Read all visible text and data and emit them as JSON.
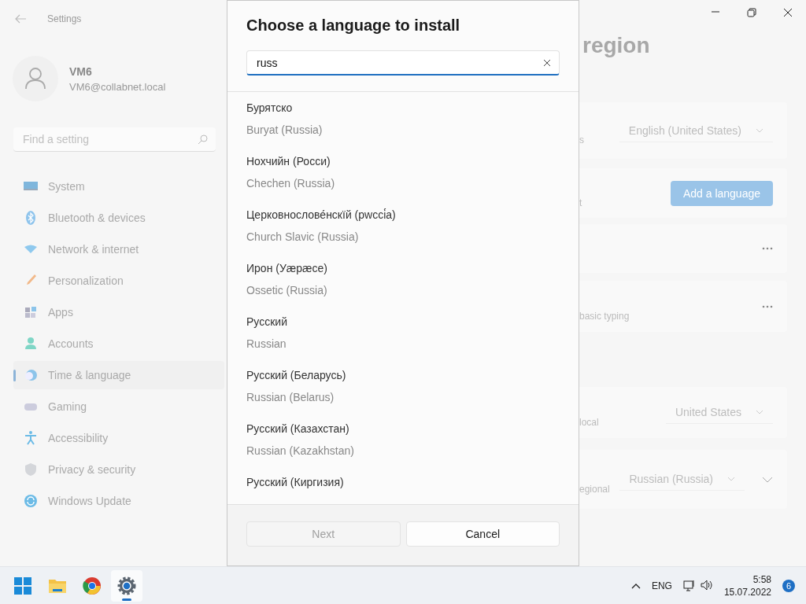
{
  "window": {
    "title": "Settings"
  },
  "account": {
    "name": "VM6",
    "email": "VM6@collabnet.local"
  },
  "sidebar": {
    "search": {
      "placeholder": "Find a setting"
    },
    "items": [
      {
        "label": "System",
        "selected": false
      },
      {
        "label": "Bluetooth & devices",
        "selected": false
      },
      {
        "label": "Network & internet",
        "selected": false
      },
      {
        "label": "Personalization",
        "selected": false
      },
      {
        "label": "Apps",
        "selected": false
      },
      {
        "label": "Accounts",
        "selected": false
      },
      {
        "label": "Time & language",
        "selected": true
      },
      {
        "label": "Gaming",
        "selected": false
      },
      {
        "label": "Accessibility",
        "selected": false
      },
      {
        "label": "Privacy & security",
        "selected": false
      },
      {
        "label": "Windows Update",
        "selected": false
      }
    ]
  },
  "page": {
    "heading": "region",
    "cards": [
      {
        "label": "s",
        "control": {
          "kind": "dropdown",
          "value": "English (United States)"
        },
        "expandable": false
      },
      {
        "label": "t",
        "control": {
          "kind": "button",
          "value": "Add a language"
        },
        "expandable": false
      },
      {
        "control": {
          "kind": "more"
        },
        "expandable": false
      },
      {
        "label": "basic typing",
        "control": {
          "kind": "more"
        },
        "expandable": false
      },
      {
        "label": "local",
        "control": {
          "kind": "dropdown",
          "value": "United States"
        },
        "expandable": false
      },
      {
        "label": "egional",
        "control": {
          "kind": "dropdown",
          "value": "Russian (Russia)"
        },
        "expandable": true
      }
    ]
  },
  "dialog": {
    "title": "Choose a language to install",
    "search": {
      "value": "russ"
    },
    "languages": [
      {
        "native": "Бурятско",
        "english": "Buryat (Russia)"
      },
      {
        "native": "Нохчийн (Росси)",
        "english": "Chechen (Russia)"
      },
      {
        "native": "Церковнослове́нскїй (рwссі́а)",
        "english": "Church Slavic (Russia)"
      },
      {
        "native": "Ирон (Уæрæсе)",
        "english": "Ossetic (Russia)"
      },
      {
        "native": "Русский",
        "english": "Russian"
      },
      {
        "native": "Русский (Беларусь)",
        "english": "Russian (Belarus)"
      },
      {
        "native": "Русский (Казахстан)",
        "english": "Russian (Kazakhstan)"
      },
      {
        "native": "Русский (Киргизия)"
      }
    ],
    "buttons": [
      {
        "label": "Next",
        "disabled": true
      },
      {
        "label": "Cancel",
        "disabled": false
      }
    ]
  },
  "taskbar": {
    "apps": [
      {
        "kind": "start",
        "selected": false
      },
      {
        "kind": "files",
        "selected": false
      },
      {
        "kind": "browser",
        "selected": false
      },
      {
        "kind": "settings",
        "selected": true
      }
    ],
    "language": "ENG",
    "time": "5:58",
    "date": "15.07.2022",
    "badge": "6"
  }
}
